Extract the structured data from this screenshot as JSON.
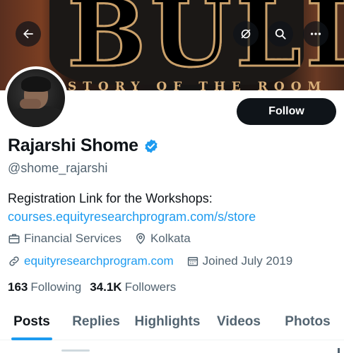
{
  "profile": {
    "name": "Rajarshi Shome",
    "handle": "@shome_rajarshi",
    "follow_label": "Follow",
    "bio_line1": "Registration Link for the Workshops:",
    "bio_link": "courses.equityresearchprogram.com/s/store",
    "category": "Financial Services",
    "location": "Kolkata",
    "website": "equityresearchprogram.com",
    "joined": "Joined July 2019",
    "following_count": "163",
    "following_label": "Following",
    "followers_count": "34.1K",
    "followers_label": "Followers"
  },
  "banner": {
    "headline": "BULL!",
    "subline": "STORY OF THE ROOM"
  },
  "tabs": [
    {
      "label": "Posts",
      "active": true
    },
    {
      "label": "Replies",
      "active": false
    },
    {
      "label": "Highlights",
      "active": false
    },
    {
      "label": "Videos",
      "active": false
    },
    {
      "label": "Photos",
      "active": false
    }
  ],
  "colors": {
    "accent": "#1d9bf0",
    "text": "#0f1419",
    "muted": "#536471"
  },
  "icons": {
    "back": "back-arrow-icon",
    "grok": "grok-icon",
    "search": "search-icon",
    "more": "more-icon",
    "verified": "verified-badge-icon",
    "briefcase": "briefcase-icon",
    "location": "location-pin-icon",
    "link": "link-icon",
    "calendar": "calendar-icon"
  }
}
